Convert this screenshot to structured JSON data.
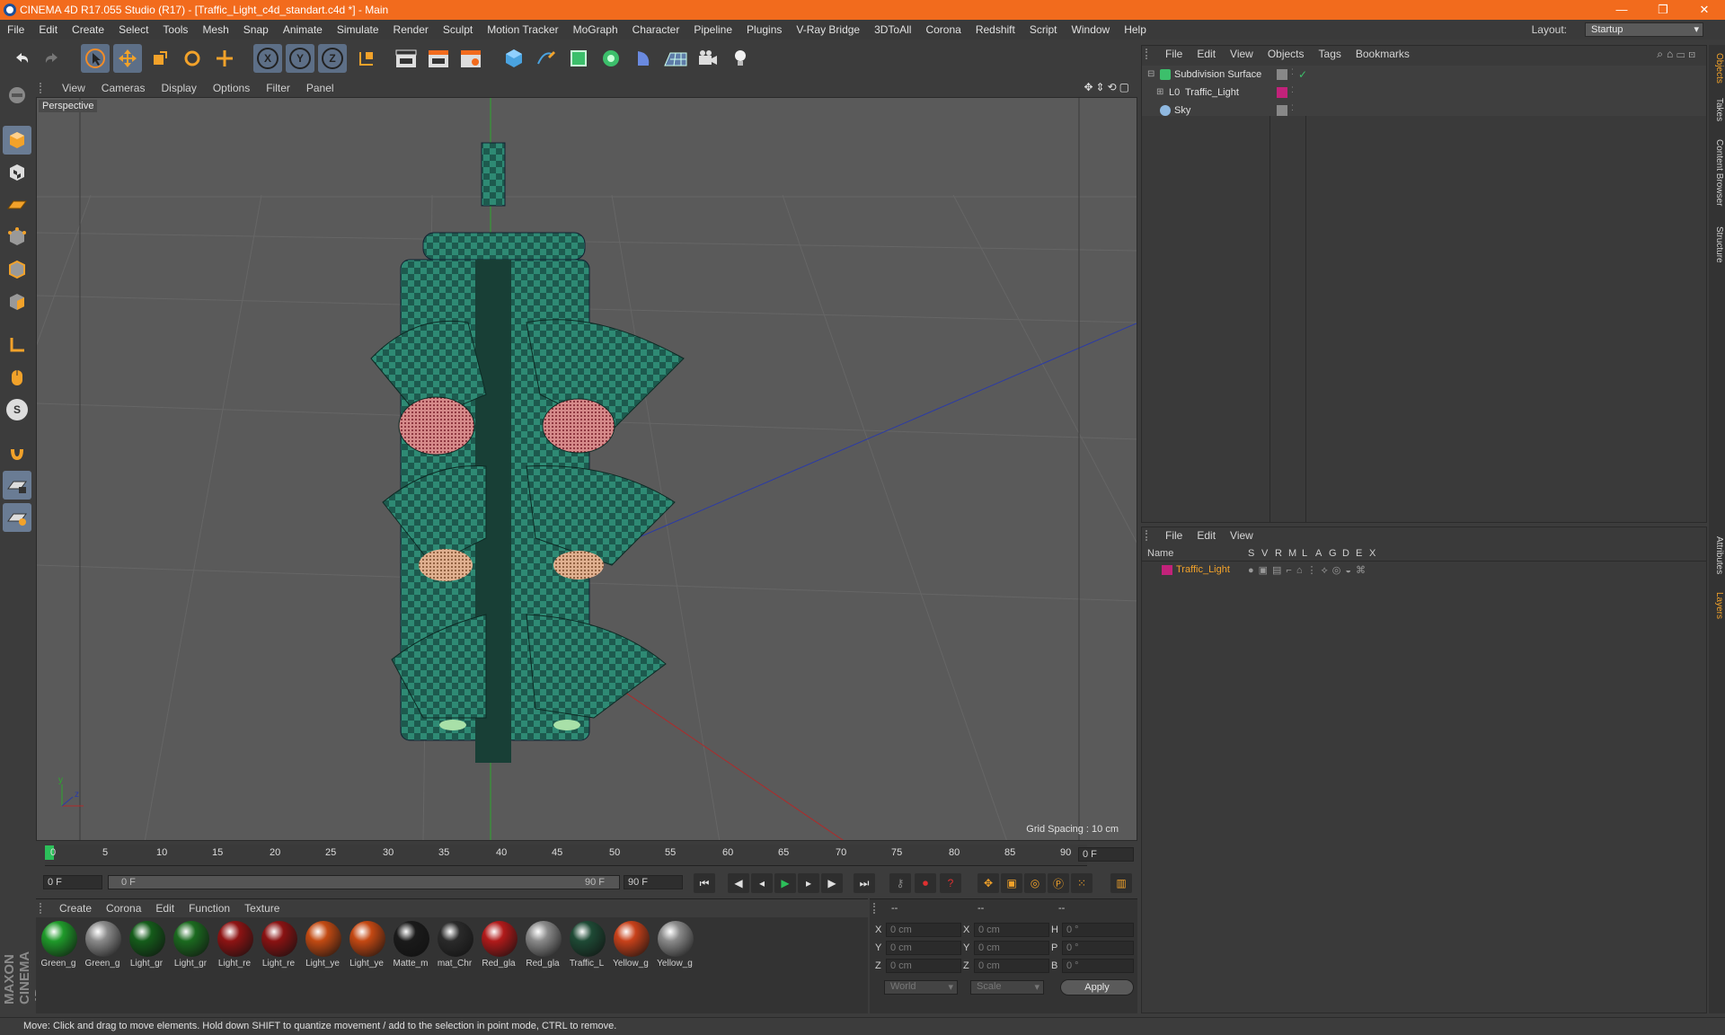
{
  "window": {
    "title": "CINEMA 4D R17.055 Studio (R17) - [Traffic_Light_c4d_standart.c4d *] - Main",
    "minimize": "—",
    "restore": "❐",
    "close": "✕"
  },
  "menubar": {
    "items": [
      "File",
      "Edit",
      "Create",
      "Select",
      "Tools",
      "Mesh",
      "Snap",
      "Animate",
      "Simulate",
      "Render",
      "Sculpt",
      "Motion Tracker",
      "MoGraph",
      "Character",
      "Pipeline",
      "Plugins",
      "V-Ray Bridge",
      "3DToAll",
      "Corona",
      "Redshift",
      "Script",
      "Window",
      "Help"
    ],
    "layout_label": "Layout:",
    "layout_value": "Startup"
  },
  "toolbar": {
    "axis_x": "X",
    "axis_y": "Y",
    "axis_z": "Z"
  },
  "viewport": {
    "menu": [
      "View",
      "Cameras",
      "Display",
      "Options",
      "Filter",
      "Panel"
    ],
    "label": "Perspective",
    "grid_spacing": "Grid Spacing : 10 cm"
  },
  "timeline": {
    "ticks": [
      "0",
      "5",
      "10",
      "15",
      "20",
      "25",
      "30",
      "35",
      "40",
      "45",
      "50",
      "55",
      "60",
      "65",
      "70",
      "75",
      "80",
      "85",
      "90"
    ],
    "current_frame": "0 F",
    "start_field": "0 F",
    "range_start": "0 F",
    "range_end": "90 F",
    "end_field": "90 F"
  },
  "materials": {
    "menu": [
      "Create",
      "Corona",
      "Edit",
      "Function",
      "Texture"
    ],
    "items": [
      {
        "label": "Green_g",
        "color": "#1f9a2a"
      },
      {
        "label": "Green_g",
        "color": "#8a8a8a"
      },
      {
        "label": "Light_gr",
        "color": "#145c1a"
      },
      {
        "label": "Light_gr",
        "color": "#1b6a1f"
      },
      {
        "label": "Light_re",
        "color": "#8e1313"
      },
      {
        "label": "Light_re",
        "color": "#8a1212"
      },
      {
        "label": "Light_ye",
        "color": "#c24a12"
      },
      {
        "label": "Light_ye",
        "color": "#c44812"
      },
      {
        "label": "Matte_m",
        "color": "#1a1a1a"
      },
      {
        "label": "mat_Chr",
        "color": "#2a2a2a"
      },
      {
        "label": "Red_gla",
        "color": "#b11a1a"
      },
      {
        "label": "Red_gla",
        "color": "#8a8a8a"
      },
      {
        "label": "Traffic_L",
        "color": "#1e4a35"
      },
      {
        "label": "Yellow_g",
        "color": "#c8411a"
      },
      {
        "label": "Yellow_g",
        "color": "#8a8a8a"
      }
    ]
  },
  "coords": {
    "header": [
      "--",
      "--",
      "--"
    ],
    "rows": [
      {
        "a": "X",
        "av": "0 cm",
        "b": "X",
        "bv": "0 cm",
        "c": "H",
        "cv": "0 °"
      },
      {
        "a": "Y",
        "av": "0 cm",
        "b": "Y",
        "bv": "0 cm",
        "c": "P",
        "cv": "0 °"
      },
      {
        "a": "Z",
        "av": "0 cm",
        "b": "Z",
        "bv": "0 cm",
        "c": "B",
        "cv": "0 °"
      }
    ],
    "world": "World",
    "scale": "Scale",
    "apply": "Apply"
  },
  "objects": {
    "menu": [
      "File",
      "Edit",
      "View",
      "Objects",
      "Tags",
      "Bookmarks"
    ],
    "rows": [
      {
        "name": "Subdivision Surface"
      },
      {
        "name": "Traffic_Light"
      },
      {
        "name": "Sky"
      }
    ]
  },
  "layers": {
    "menu": [
      "File",
      "Edit",
      "View"
    ],
    "columns": [
      "Name",
      "S",
      "V",
      "R",
      "M",
      "L",
      "A",
      "G",
      "D",
      "E",
      "X"
    ],
    "row_name": "Traffic_Light"
  },
  "right_tabs": [
    "Objects",
    "Takes",
    "Content Browser",
    "Structure",
    "Attributes",
    "Layers"
  ],
  "status": "Move: Click and drag to move elements. Hold down SHIFT to quantize movement / add to the selection in point mode, CTRL to remove.",
  "brand": "MAXON CINEMA 4D"
}
